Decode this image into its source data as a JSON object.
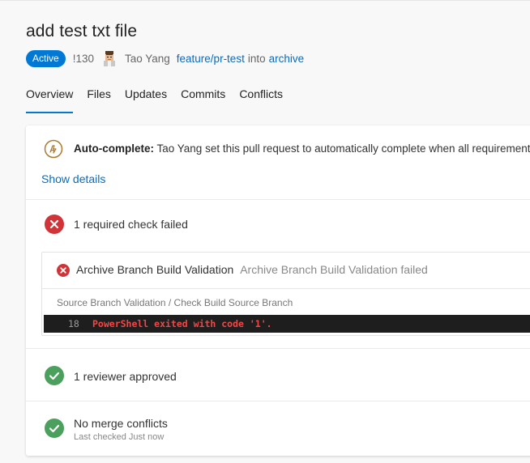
{
  "pr": {
    "title": "add test txt file",
    "status": "Active",
    "id": "!130",
    "author": "Tao Yang",
    "source_branch": "feature/pr-test",
    "into_text": "into",
    "target_branch": "archive"
  },
  "tabs": [
    "Overview",
    "Files",
    "Updates",
    "Commits",
    "Conflicts"
  ],
  "active_tab": "Overview",
  "autocomplete": {
    "label": "Auto-complete:",
    "text": "Tao Yang set this pull request to automatically complete when all requirements are met",
    "show_details": "Show details",
    "icon": "auto-complete-icon"
  },
  "checks": {
    "summary": "1 required check failed",
    "icon": "error-icon",
    "policy": {
      "name": "Archive Branch Build Validation",
      "status": "Archive Branch Build Validation failed",
      "path": "Source Branch Validation / Check Build Source Branch",
      "log_line_number": "18",
      "log_message": "PowerShell exited with code '1'."
    }
  },
  "reviewers": {
    "summary": "1 reviewer approved",
    "icon": "success-icon"
  },
  "merge": {
    "summary": "No merge conflicts",
    "subtext": "Last checked Just now",
    "icon": "success-icon"
  },
  "colors": {
    "accent": "#0078d4",
    "error": "#d13438",
    "success": "#4aa05c",
    "autocomplete": "#a87b2f"
  }
}
